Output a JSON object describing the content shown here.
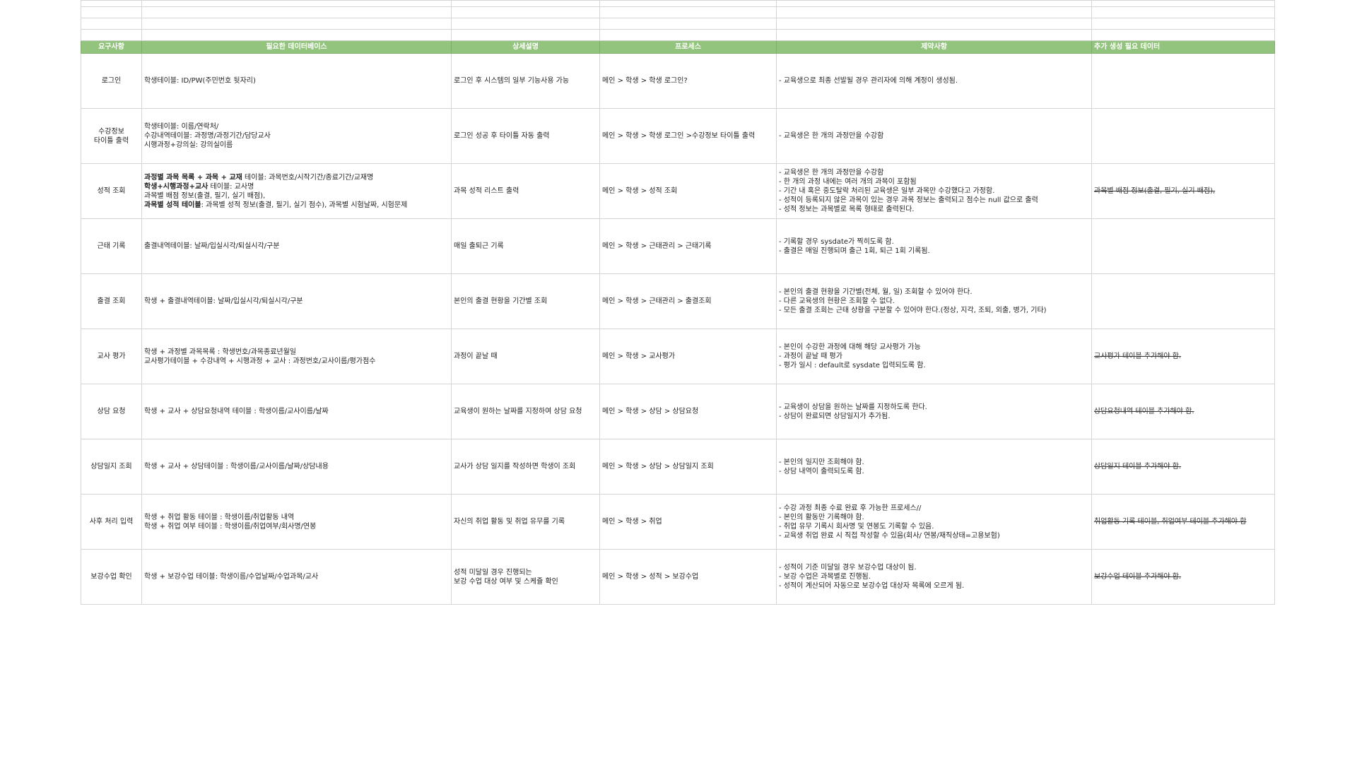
{
  "headers": {
    "requirement": "요구사항",
    "database": "필요한 데이터베이스",
    "detail": "상세설명",
    "process": "프로세스",
    "constraints": "제약사항",
    "additional": "추가 생성 필요 데이터"
  },
  "rows": [
    {
      "requirement": [
        "로그인"
      ],
      "database": [
        {
          "text": "학생테이블: ID/PW(주민번호 뒷자리)"
        }
      ],
      "detail": [
        "로그인 후 시스템의 일부 기능사용 가능"
      ],
      "process": "메인 > 학생 > 학생 로그인?",
      "constraints": [
        "- 교육생으로 최종 선발될 경우 관리자에 의해 계정이 생성됨."
      ],
      "additional": ""
    },
    {
      "requirement": [
        "수강정보",
        "타이틀 출력"
      ],
      "database": [
        {
          "text": "학생테이블: 이름/연락처/"
        },
        {
          "text": "수강내역테이블: 과정명/과정기간/담당교사"
        },
        {
          "text": "시행과정+강의실: 강의실이름"
        }
      ],
      "detail": [
        "로그인 성공 후 타이틀 자동 출력"
      ],
      "process": "메인 > 학생 > 학생 로그인 >수강정보 타이틀 출력",
      "constraints": [
        "- 교육생은 한 개의 과정만을 수강함"
      ],
      "additional": ""
    },
    {
      "requirement": [
        "성적 조회"
      ],
      "database": [
        {
          "bold": "과정별 과목 목록 + 과목 + 교재",
          "text": " 테이블: 과목번호/시작기간/종료기간/교재명"
        },
        {
          "bold": "학생+시행과정+교사",
          "text": " 테이블: 교사명"
        },
        {
          "text": "과목별 배점 정보(출결, 필기, 실기 배점),"
        },
        {
          "bold": "과목별 성적 테이블",
          "text": ": 과목별 성적 정보(출결, 필기, 실기 점수), 과목별 시험날짜, 시험문제"
        }
      ],
      "detail": [
        "과목 성적 리스트 출력"
      ],
      "process": "메인 > 학생 > 성적 조회",
      "constraints": [
        "- 교육생은 한 개의 과정만을 수강함",
        "- 한 개의 과정 내에는 여러 개의 과목이 포함됨",
        "- 기간 내 혹은 중도탈락 처리된 교육생은 일부 과목만 수강했다고 가정함.",
        "- 성적이 등록되지 않은 과목이 있는 경우 과목 정보는 출력되고 점수는 null 값으로 출력",
        "- 성적 정보는 과목별로 목록 형태로 출력된다."
      ],
      "additional": "과목별 배점 정보(출결, 필기, 실기 배점),"
    },
    {
      "requirement": [
        "근태 기록"
      ],
      "database": [
        {
          "text": "출결내역테이블: 날짜/입실시각/퇴실시각/구분"
        }
      ],
      "detail": [
        "매일 출퇴근 기록"
      ],
      "process": "메인 > 학생 > 근태관리 > 근태기록",
      "constraints": [
        "- 기록할 경우 sysdate가 찍히도록 함.",
        "- 출결은 매일 진행되며 출근 1회, 퇴근 1회 기록됨."
      ],
      "additional": ""
    },
    {
      "requirement": [
        "출결 조회"
      ],
      "database": [
        {
          "text": "학생 + 출결내역테이블: 날짜/입실시각/퇴실시각/구분"
        }
      ],
      "detail": [
        "본인의 출결 현황을 기간별 조회"
      ],
      "process": "메인 > 학생 > 근태관리 > 출결조회",
      "constraints": [
        "- 본인의 출결 현황을 기간별(전체, 월, 일) 조회할 수 있어야 한다.",
        "- 다른 교육생의 현황은 조회할 수 없다.",
        "- 모든 출결 조회는 근태 상황을 구분할 수 있어야 한다.(정상, 지각, 조퇴, 외출, 병가, 기타)"
      ],
      "additional": ""
    },
    {
      "requirement": [
        "교사 평가"
      ],
      "database": [
        {
          "text": "학생 + 과정별 과목목록 : 학생번호/과목종료년월일"
        },
        {
          "text": "교사평가테이블 + 수강내역 + 시행과정 + 교사 : 과정번호/교사이름/평가점수"
        }
      ],
      "detail": [
        "과정이 끝날 때"
      ],
      "process": "메인 > 학생 > 교사평가",
      "constraints": [
        "- 본인이 수강한 과정에 대해 해당 교사평가 가능",
        "- 과정이 끝날 때 평가",
        "- 평가 일시 : default로 sysdate 입력되도록 함."
      ],
      "additional": "교사평가 테이블 추가해야 함."
    },
    {
      "requirement": [
        "상담 요청"
      ],
      "database": [
        {
          "text": "학생 + 교사 + 상담요청내역 테이블 : 학생이름/교사이름/날짜"
        }
      ],
      "detail": [
        "교육생이 원하는 날짜를 지정하여 상담 요청"
      ],
      "process": "메인 > 학생 > 상담 > 상담요청",
      "constraints": [
        "- 교육생이 상담을 원하는 날짜를 지정하도록 한다.",
        "- 상담이 완료되면 상담일지가 추가됨."
      ],
      "additional": "상담요청내역 테이블 추가해야 함."
    },
    {
      "requirement": [
        "상담일지 조회"
      ],
      "database": [
        {
          "text": "학생 + 교사 + 상담테이블 : 학생이름/교사이름/날짜/상담내용"
        }
      ],
      "detail": [
        "교사가 상담 일지를 작성하면 학생이 조회"
      ],
      "process": "메인 > 학생 > 상담 > 상담일지 조회",
      "constraints": [
        "- 본인의 일지만 조회해야 함.",
        "- 상담 내역이 출력되도록 함."
      ],
      "additional": "상담일지 테이블 추가해야 함."
    },
    {
      "requirement": [
        "사후 처리 입력"
      ],
      "database": [
        {
          "text": "학생 + 취업 활동 테이블 : 학생이름/취업활동 내역"
        },
        {
          "text": "학생 + 취업 여부 테이블 : 학생이름/취업여부/회사명/연봉"
        }
      ],
      "detail": [
        "자신의 취업 활동 및 취업 유무를 기록"
      ],
      "process": "메인 > 학생 > 취업",
      "constraints": [
        "- 수강 과정 최종 수료 완료 후 가능한 프로세스//",
        "- 본인의 활동만 기록해야 함.",
        "- 취업 유무 기록시 회사명 및 연봉도 기록할 수 있음.",
        "- 교육생 취업 완료 시 직접 작성할 수 있음(회사/ 연봉/재직상태=고용보험)"
      ],
      "additional": "취업활동 기록 테이블, 취업여부 테이블 추가해야 함"
    },
    {
      "requirement": [
        "보강수업 확인"
      ],
      "database": [
        {
          "text": "학생 + 보강수업 테이블: 학생이름/수업날짜/수업과목/교사"
        }
      ],
      "detail": [
        "성적 미달일 경우 진행되는",
        "보강 수업 대상 여부 및 스케쥴 확인"
      ],
      "process": "메인 > 학생 > 성적 > 보강수업",
      "constraints": [
        "- 성적이 기준 미달일 경우 보강수업 대상이 됨.",
        "- 보강 수업은 과목별로 진행됨.",
        "- 성적이 계산되어 자동으로 보강수업 대상자 목록에 오르게 됨."
      ],
      "additional": "보강수업 테이블 추가해야 함."
    }
  ]
}
